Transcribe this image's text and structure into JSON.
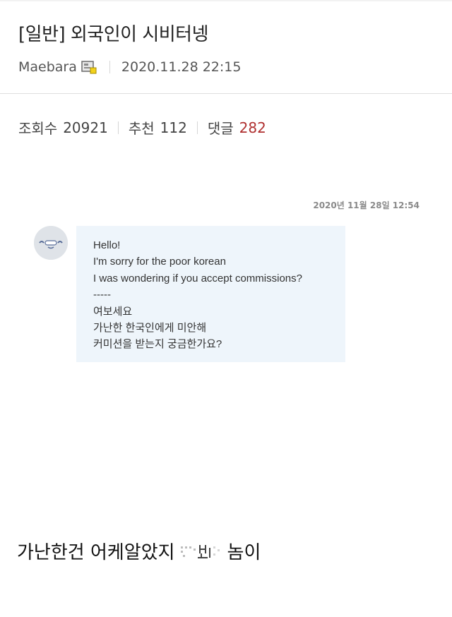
{
  "post": {
    "title": "[일반] 외국인이 시비터넹",
    "author": "Maebara",
    "datetime": "2020.11.28 22:15"
  },
  "stats": {
    "views_label": "조회수",
    "views": "20921",
    "recommend_label": "추천",
    "recommend": "112",
    "comments_label": "댓글",
    "comments": "282"
  },
  "message": {
    "date": "2020년 11월 28일 12:54",
    "lines": [
      "Hello!",
      "I'm sorry for the poor korean",
      "I was wondering if you accept commissions?",
      "-----",
      "여보세요",
      "가난한 한국인에게 미안해",
      "커미션을 받는지 궁금한가요?"
    ]
  },
  "caption": {
    "before": "가난한건 어케알았지",
    "after": "놈이"
  },
  "colors": {
    "comment_count": "#b03030",
    "bubble_bg": "#eef5fb",
    "avatar_bg": "#dfe3e8"
  },
  "icons": {
    "author_level": "level-badge-icon",
    "avatar": "avatar-icon",
    "censored": "censored-mosaic"
  }
}
